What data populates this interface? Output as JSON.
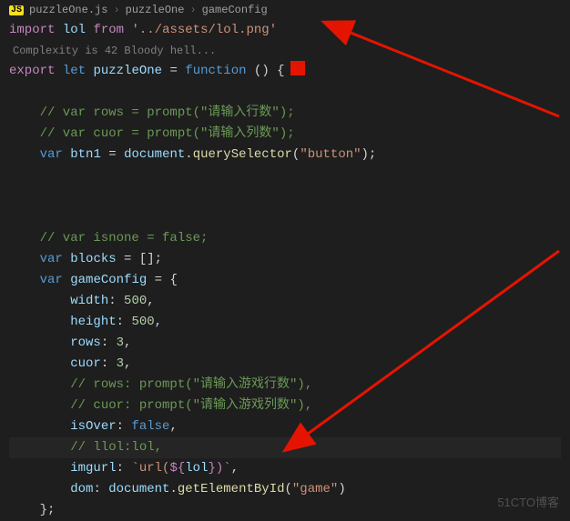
{
  "breadcrumb": {
    "badge": "JS",
    "items": [
      "puzzleOne.js",
      "puzzleOne",
      "gameConfig"
    ]
  },
  "codelens": "Complexity is 42 Bloody hell...",
  "code": {
    "l1": {
      "import": "import",
      "lol": "lol",
      "from": "from",
      "path": "'../assets/lol.png'"
    },
    "l2": {
      "export": "export",
      "let": "let",
      "name": "puzzleOne",
      "eq": " = ",
      "function": "function",
      "paren": " () {"
    },
    "l3": "",
    "l4": "    // var rows = prompt(\"请输入行数\");",
    "l5": "    // var cuor = prompt(\"请输入列数\");",
    "l6": {
      "var": "var",
      "btn1": "btn1",
      "doc": "document",
      "fn": "querySelector",
      "arg": "\"button\""
    },
    "l7": "",
    "l8": "",
    "l9": "",
    "l10": "    // var isnone = false;",
    "l11": {
      "var": "var",
      "blocks": "blocks",
      "val": " = [];"
    },
    "l12": {
      "var": "var",
      "name": "gameConfig",
      "val": " = {"
    },
    "l13": {
      "prop": "width",
      "val": "500"
    },
    "l14": {
      "prop": "height",
      "val": "500"
    },
    "l15": {
      "prop": "rows",
      "val": "3"
    },
    "l16": {
      "prop": "cuor",
      "val": "3"
    },
    "l17": "        // rows: prompt(\"请输入游戏行数\"),",
    "l18": "        // cuor: prompt(\"请输入游戏列数\"),",
    "l19": {
      "prop": "isOver",
      "val": "false"
    },
    "l20": "        // llol:lol,",
    "l21": {
      "prop": "imgurl",
      "pre": "`url(",
      "mid": "${",
      "lol": "lol",
      "end": "})`"
    },
    "l22": {
      "prop": "dom",
      "doc": "document",
      "fn": "getElementById",
      "arg": "\"game\""
    },
    "l23": "    };"
  },
  "watermark": "51CTO博客"
}
